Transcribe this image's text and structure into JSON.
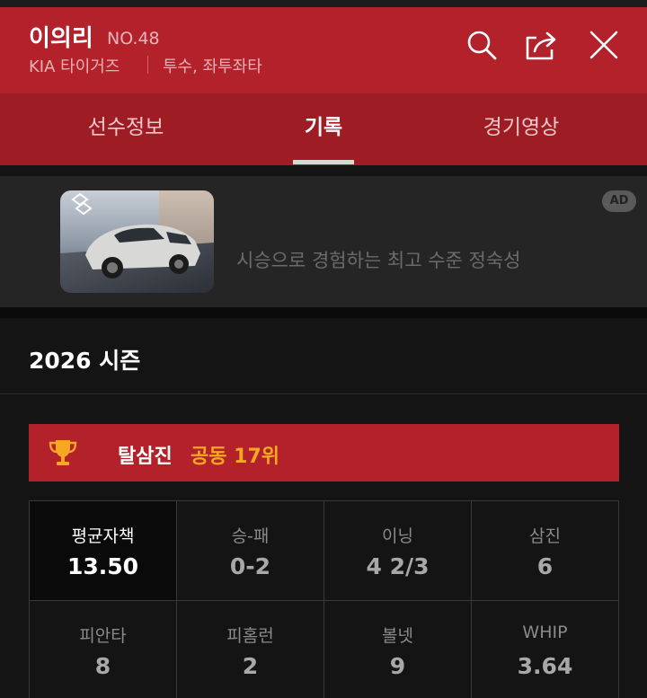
{
  "header": {
    "player_name": "이의리",
    "player_number": "NO.48",
    "team": "KIA 타이거즈",
    "position": "투수, 좌투좌타",
    "icons": [
      "search-icon",
      "share-icon",
      "close-icon"
    ]
  },
  "tabs": [
    {
      "label": "선수정보",
      "active": false
    },
    {
      "label": "기록",
      "active": true
    },
    {
      "label": "경기영상",
      "active": false
    }
  ],
  "ad": {
    "text": "시승으로 경험하는 최고 수준 정숙성",
    "badge": "AD"
  },
  "season": {
    "title": "2026 시즌"
  },
  "ranking": {
    "label": "탈삼진",
    "value": "공동 17위",
    "icon": "trophy-icon"
  },
  "stats": [
    {
      "label": "평균자책",
      "value": "13.50",
      "highlighted": true
    },
    {
      "label": "승-패",
      "value": "0-2"
    },
    {
      "label": "이닝",
      "value": "4 2/3"
    },
    {
      "label": "삼진",
      "value": "6"
    },
    {
      "label": "피안타",
      "value": "8"
    },
    {
      "label": "피홈런",
      "value": "2"
    },
    {
      "label": "볼넷",
      "value": "9"
    },
    {
      "label": "WHIP",
      "value": "3.64"
    }
  ],
  "colors": {
    "header": "#b3212b",
    "tabs": "#9e1d25",
    "rank_accent": "#f7a823",
    "background": "#141414"
  }
}
